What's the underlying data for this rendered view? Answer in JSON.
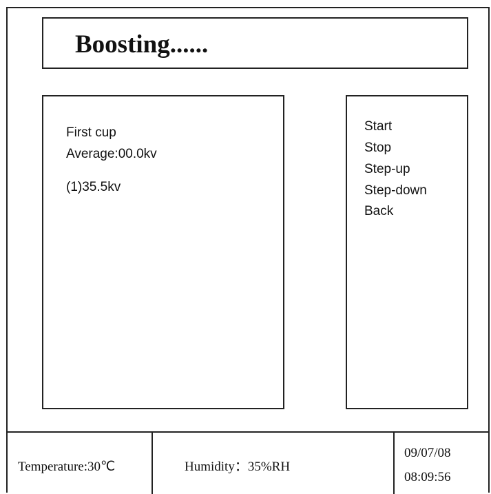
{
  "status": {
    "title": "Boosting......"
  },
  "data_panel": {
    "cup_label": "First cup",
    "average": "Average:00.0kv",
    "readings": [
      "(1)35.5kv"
    ]
  },
  "menu": {
    "items": [
      "Start",
      "Stop",
      "Step-up",
      "Step-down",
      "Back"
    ]
  },
  "footer": {
    "temperature": "Temperature:30℃",
    "humidity": "Humidity：35%RH",
    "date": "09/07/08",
    "time": "08:09:56"
  }
}
